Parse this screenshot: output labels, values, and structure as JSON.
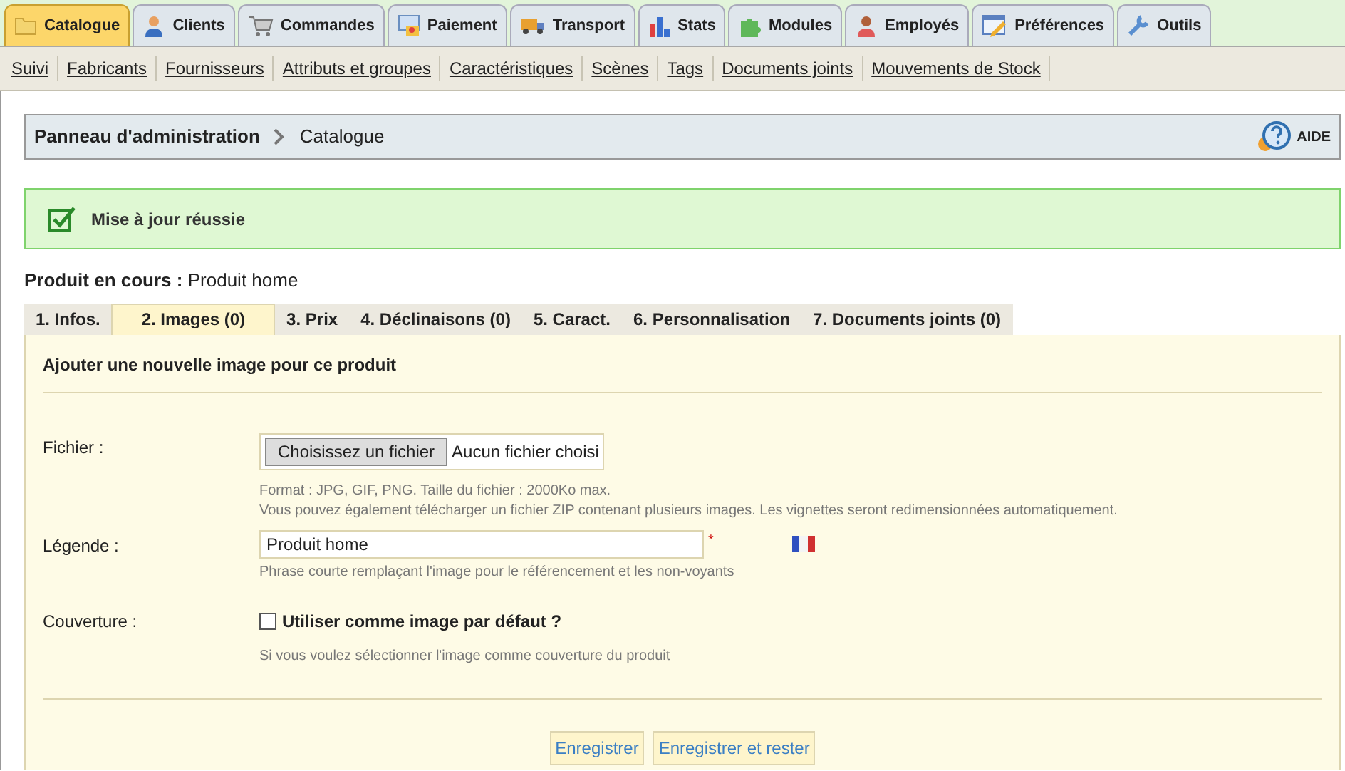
{
  "main_tabs": [
    {
      "label": "Catalogue",
      "selected": true
    },
    {
      "label": "Clients",
      "selected": false
    },
    {
      "label": "Commandes",
      "selected": false
    },
    {
      "label": "Paiement",
      "selected": false
    },
    {
      "label": "Transport",
      "selected": false
    },
    {
      "label": "Stats",
      "selected": false
    },
    {
      "label": "Modules",
      "selected": false
    },
    {
      "label": "Employés",
      "selected": false
    },
    {
      "label": "Préférences",
      "selected": false
    },
    {
      "label": "Outils",
      "selected": false
    }
  ],
  "sub_nav": [
    "Suivi",
    "Fabricants",
    "Fournisseurs",
    "Attributs et groupes",
    "Caractéristiques",
    "Scènes",
    "Tags",
    "Documents joints",
    "Mouvements de Stock"
  ],
  "breadcrumb": {
    "root": "Panneau d'administration",
    "current": "Catalogue",
    "help": "AIDE"
  },
  "alert": {
    "message": "Mise à jour réussie"
  },
  "current_product": {
    "label": "Produit en cours :",
    "value": "Produit home"
  },
  "product_tabs": [
    {
      "label": "1. Infos.",
      "selected": false
    },
    {
      "label": "2. Images (0)",
      "selected": true
    },
    {
      "label": "3. Prix",
      "selected": false
    },
    {
      "label": "4. Déclinaisons (0)",
      "selected": false
    },
    {
      "label": "5. Caract.",
      "selected": false
    },
    {
      "label": "6. Personnalisation",
      "selected": false
    },
    {
      "label": "7. Documents joints (0)",
      "selected": false
    }
  ],
  "form": {
    "title": "Ajouter une nouvelle image pour ce produit",
    "file": {
      "label": "Fichier :",
      "button": "Choisissez un fichier",
      "status": "Aucun fichier choisi",
      "hints": [
        "Format : JPG, GIF, PNG. Taille du fichier : 2000Ko max.",
        "Vous pouvez également télécharger un fichier ZIP contenant plusieurs images. Les vignettes seront redimensionnées automatiquement."
      ]
    },
    "caption": {
      "label": "Légende :",
      "value": "Produit home",
      "required_mark": "*",
      "hint": "Phrase courte remplaçant l'image pour le référencement et les non-voyants"
    },
    "cover": {
      "label": "Couverture :",
      "checkbox_label": "Utiliser comme image par défaut ?",
      "checked": false,
      "hint": "Si vous voulez sélectionner l'image comme couverture du produit"
    },
    "buttons": [
      "Enregistrer",
      "Enregistrer et rester"
    ]
  }
}
